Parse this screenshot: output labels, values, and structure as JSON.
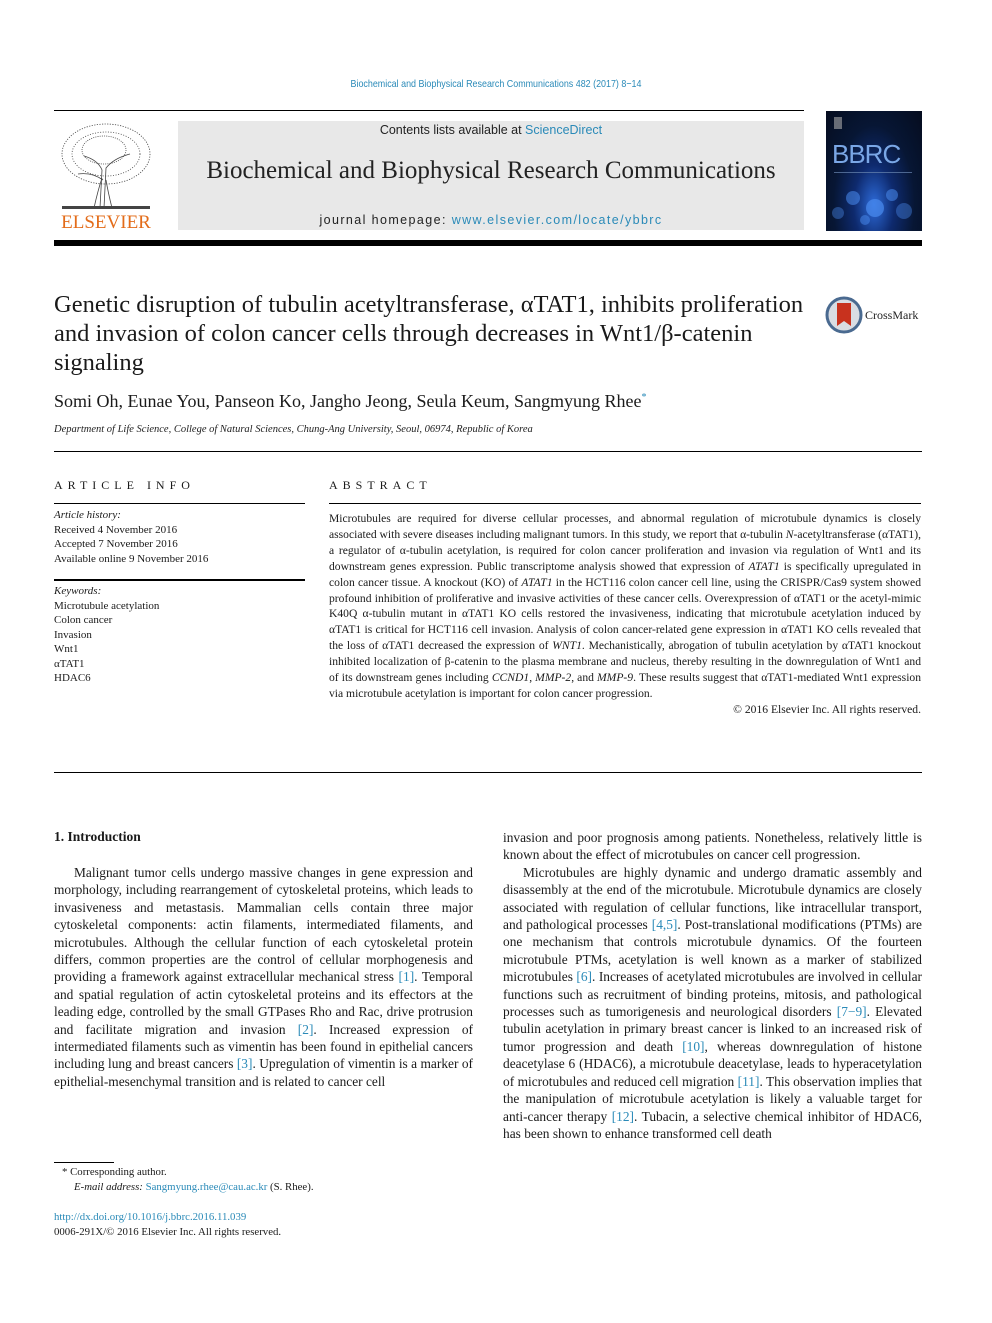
{
  "header": {
    "running_head": "Biochemical and Biophysical Research Communications 482 (2017) 8−14",
    "contents_prefix": "Contents lists available at ",
    "contents_link": "ScienceDirect",
    "journal_name": "Biochemical and Biophysical Research Communications",
    "homepage_prefix": "journal homepage: ",
    "homepage_link": "www.elsevier.com/locate/ybbrc",
    "publisher_logo": "ELSEVIER",
    "cover_title": "BBRC"
  },
  "article": {
    "title": "Genetic disruption of tubulin acetyltransferase, αTAT1, inhibits proliferation and invasion of colon cancer cells through decreases in Wnt1/β-catenin signaling",
    "crossmark_label": "CrossMark",
    "authors": "Somi Oh, Eunae You, Panseon Ko, Jangho Jeong, Seula Keum, Sangmyung Rhee",
    "corresponding_mark": "*",
    "affiliation": "Department of Life Science, College of Natural Sciences, Chung-Ang University, Seoul, 06974, Republic of Korea"
  },
  "article_info": {
    "heading": "ARTICLE INFO",
    "history_label": "Article history:",
    "history": [
      "Received 4 November 2016",
      "Accepted 7 November 2016",
      "Available online 9 November 2016"
    ],
    "keywords_label": "Keywords:",
    "keywords": [
      "Microtubule acetylation",
      "Colon cancer",
      "Invasion",
      "Wnt1",
      "αTAT1",
      "HDAC6"
    ]
  },
  "abstract": {
    "heading": "ABSTRACT",
    "segments": [
      {
        "t": "Microtubules are required for diverse cellular processes, and abnormal regulation of microtubule dynamics is closely associated with severe diseases including malignant tumors. In this study, we report that α-tubulin "
      },
      {
        "t": "N",
        "i": true
      },
      {
        "t": "-acetyltransferase (αTAT1), a regulator of α-tubulin acetylation, is required for colon cancer proliferation and invasion via regulation of Wnt1 and its downstream genes expression. Public transcriptome analysis showed that expression of "
      },
      {
        "t": "ATAT1",
        "i": true
      },
      {
        "t": " is specifically upregulated in colon cancer tissue. A knockout (KO) of "
      },
      {
        "t": "ATAT1",
        "i": true
      },
      {
        "t": " in the HCT116 colon cancer cell line, using the CRISPR/Cas9 system showed profound inhibition of proliferative and invasive activities of these cancer cells. Overexpression of αTAT1 or the acetyl-mimic K40Q α-tubulin mutant in αTAT1 KO cells restored the invasiveness, indicating that microtubule acetylation induced by αTAT1 is critical for HCT116 cell invasion. Analysis of colon cancer-related gene expression in αTAT1 KO cells revealed that the loss of αTAT1 decreased the expression of "
      },
      {
        "t": "WNT1",
        "i": true
      },
      {
        "t": ". Mechanistically, abrogation of tubulin acetylation by αTAT1 knockout inhibited localization of β-catenin to the plasma membrane and nucleus, thereby resulting in the downregulation of Wnt1 and of its downstream genes including "
      },
      {
        "t": "CCND1",
        "i": true
      },
      {
        "t": ", "
      },
      {
        "t": "MMP-2",
        "i": true
      },
      {
        "t": ", and "
      },
      {
        "t": "MMP-9",
        "i": true
      },
      {
        "t": ". These results suggest that αTAT1-mediated Wnt1 expression via microtubule acetylation is important for colon cancer progression."
      }
    ],
    "copyright": "© 2016 Elsevier Inc. All rights reserved."
  },
  "introduction": {
    "heading": "1.  Introduction",
    "left_column": [
      {
        "t": "Malignant tumor cells undergo massive changes in gene expression and morphology, including rearrangement of cytoskeletal proteins, which leads to invasiveness and metastasis. Mammalian cells contain three major cytoskeletal components: actin filaments, intermediated filaments, and microtubules. Although the cellular function of each cytoskeletal protein differs, common properties are the control of cellular morphogenesis and providing a framework against extracellular mechanical stress "
      },
      {
        "t": "[1]",
        "c": true
      },
      {
        "t": ". Temporal and spatial regulation of actin cytoskeletal proteins and its effectors at the leading edge, controlled by the small GTPases Rho and Rac, drive protrusion and facilitate migration and invasion "
      },
      {
        "t": "[2]",
        "c": true
      },
      {
        "t": ". Increased expression of intermediated filaments such as vimentin has been found in epithelial cancers including lung and breast cancers "
      },
      {
        "t": "[3]",
        "c": true
      },
      {
        "t": ". Upregulation of vimentin is a marker of epithelial-mesenchymal transition and is related to cancer cell"
      }
    ],
    "right_para1": "invasion and poor prognosis among patients. Nonetheless, relatively little is known about the effect of microtubules on cancer cell progression.",
    "right_para2": [
      {
        "t": "Microtubules are highly dynamic and undergo dramatic assembly and disassembly at the end of the microtubule. Microtubule dynamics are closely associated with regulation of cellular functions, like intracellular transport, and pathological processes "
      },
      {
        "t": "[4,5]",
        "c": true
      },
      {
        "t": ". Post-translational modifications (PTMs) are one mechanism that controls microtubule dynamics. Of the fourteen microtubule PTMs, acetylation is well known as a marker of stabilized microtubules "
      },
      {
        "t": "[6]",
        "c": true
      },
      {
        "t": ". Increases of acetylated microtubules are involved in cellular functions such as recruitment of binding proteins, mitosis, and pathological processes such as tumorigenesis and neurological disorders "
      },
      {
        "t": "[7−9]",
        "c": true
      },
      {
        "t": ". Elevated tubulin acetylation in primary breast cancer is linked to an increased risk of tumor progression and death "
      },
      {
        "t": "[10]",
        "c": true
      },
      {
        "t": ", whereas downregulation of histone deacetylase 6 (HDAC6), a microtubule deacetylase, leads to hyperacetylation of microtubules and reduced cell migration "
      },
      {
        "t": "[11]",
        "c": true
      },
      {
        "t": ". This observation implies that the manipulation of microtubule acetylation is likely a valuable target for anti-cancer therapy "
      },
      {
        "t": "[12]",
        "c": true
      },
      {
        "t": ". Tubacin, a selective chemical inhibitor of HDAC6, has been shown to enhance transformed cell death"
      }
    ]
  },
  "footnotes": {
    "corresponding": "* Corresponding author.",
    "email_label": "E-mail address: ",
    "email": "Sangmyung.rhee@cau.ac.kr",
    "email_suffix": " (S. Rhee).",
    "doi": "http://dx.doi.org/10.1016/j.bbrc.2016.11.039",
    "issn_copyright": "0006-291X/© 2016 Elsevier Inc. All rights reserved."
  }
}
